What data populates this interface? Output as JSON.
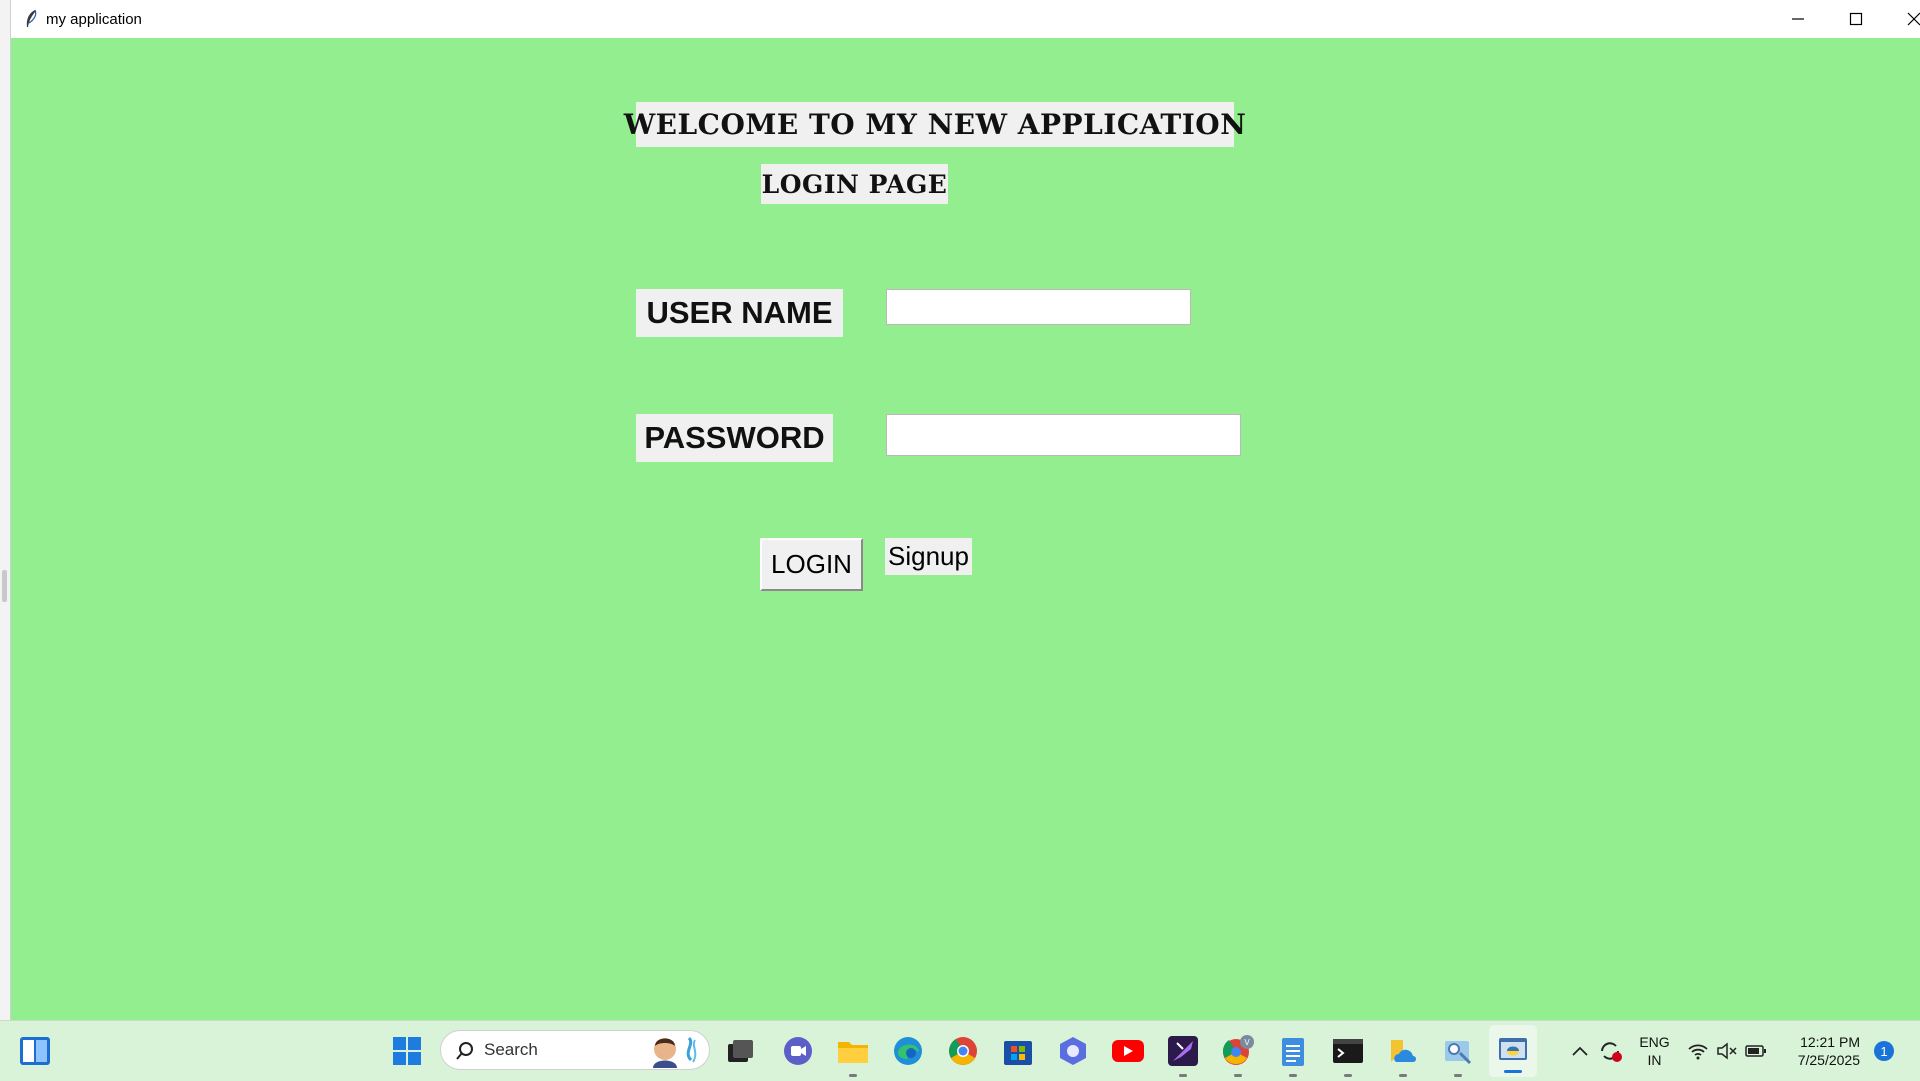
{
  "window": {
    "title": "my application"
  },
  "form": {
    "heading": "WELCOME TO MY NEW APPLICATION",
    "subheading": "LOGIN PAGE",
    "username_label": "USER NAME",
    "username_value": "",
    "password_label": "PASSWORD",
    "password_value": "",
    "login_label": "LOGIN",
    "signup_label": "Signup"
  },
  "colors": {
    "background": "#93ee90",
    "label_bg": "#f0f0f0"
  },
  "taskbar": {
    "search_label": "Search",
    "pinned": [
      "widgets-icon",
      "start-icon",
      "search-icon",
      "task-view-icon",
      "meet-icon",
      "file-explorer-icon",
      "edge-icon",
      "chrome-icon",
      "store-icon",
      "copilot-icon",
      "youtube-icon",
      "visual-studio-icon",
      "chrome-profile-icon",
      "notepad-icon",
      "terminal-icon",
      "onedrive-icon",
      "settings-app-icon",
      "python-icon"
    ],
    "language": "ENG",
    "region": "IN",
    "time": "12:21 PM",
    "date": "7/25/2025",
    "notification_count": "1"
  }
}
